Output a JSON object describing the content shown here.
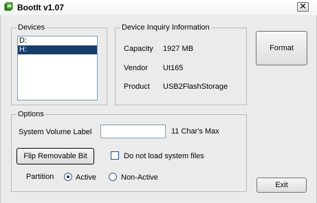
{
  "window": {
    "title": "BootIt v1.07",
    "close_glyph": "✕"
  },
  "devices": {
    "title": "Devices",
    "items": [
      {
        "label": "D:",
        "selected": false
      },
      {
        "label": "H:",
        "selected": true
      }
    ]
  },
  "inquiry": {
    "title": "Device Inquiry Information",
    "capacity_label": "Capacity",
    "capacity_value": "1927 MB",
    "vendor_label": "Vendor",
    "vendor_value": "Ut165",
    "product_label": "Product",
    "product_value": "USB2FlashStorage"
  },
  "options": {
    "title": "Options",
    "volume_label": "System Volume Label",
    "volume_value": "",
    "max_hint": "11 Char's Max",
    "flip_button": "Flip Removable Bit",
    "no_system_files_label": "Do not load system files",
    "no_system_files_checked": false,
    "partition_label": "Partition",
    "active_label": "Active",
    "nonactive_label": "Non-Active",
    "selected_partition": "active"
  },
  "buttons": {
    "format": "Format",
    "exit": "Exit"
  }
}
